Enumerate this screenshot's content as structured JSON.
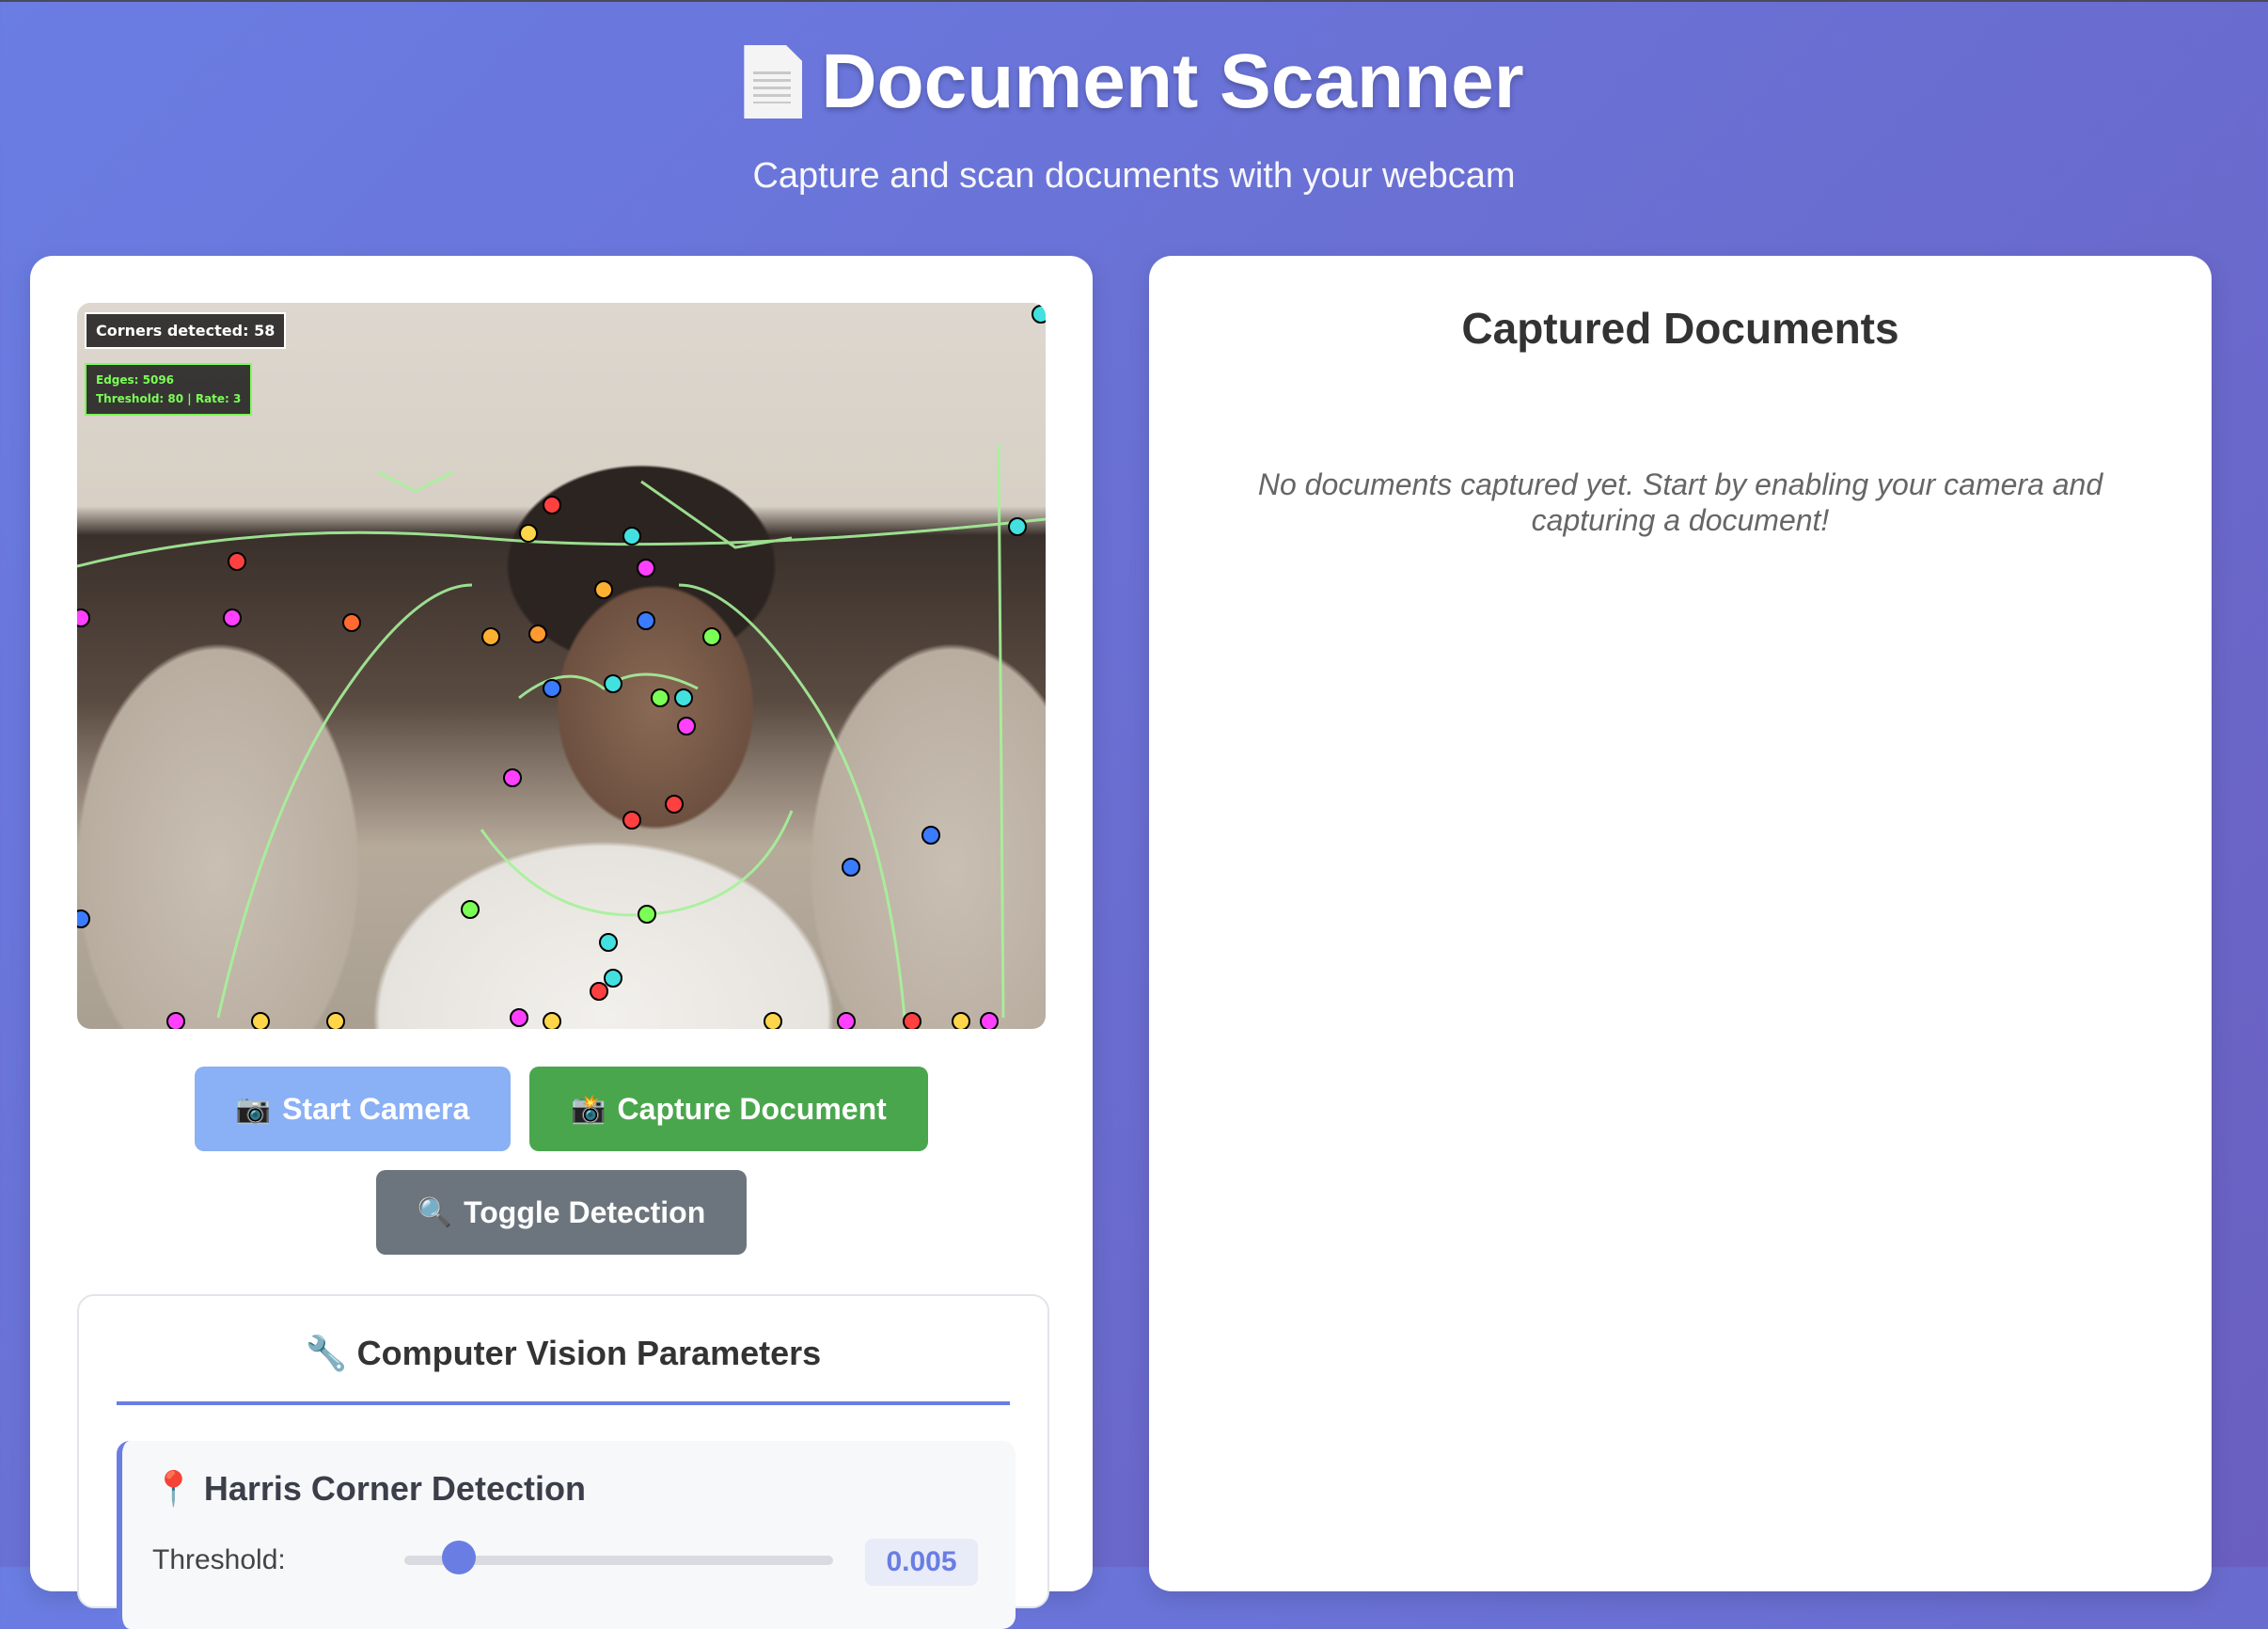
{
  "header": {
    "icon": "document-icon",
    "title": "Document Scanner",
    "subtitle": "Capture and scan documents with your webcam"
  },
  "video": {
    "corners_label": "Corners detected: 58",
    "edges_label": "Edges: 5096",
    "threshold_rate_label": "Threshold: 80 | Rate: 3"
  },
  "buttons": {
    "start_camera": "Start Camera",
    "capture_document": "Capture Document",
    "toggle_detection": "Toggle Detection"
  },
  "params": {
    "title": "Computer Vision Parameters",
    "harris": {
      "title": "Harris Corner Detection",
      "threshold_label": "Threshold:",
      "threshold_value": "0.005"
    }
  },
  "captured": {
    "title": "Captured Documents",
    "empty_message": "No documents captured yet. Start by enabling your camera and capturing a document!"
  },
  "colors": {
    "accent": "#6a7de3",
    "start_button": "#8ab0f5",
    "capture_button": "#4aa64d",
    "toggle_button": "#6c757d",
    "overlay_green": "#7bff56"
  }
}
